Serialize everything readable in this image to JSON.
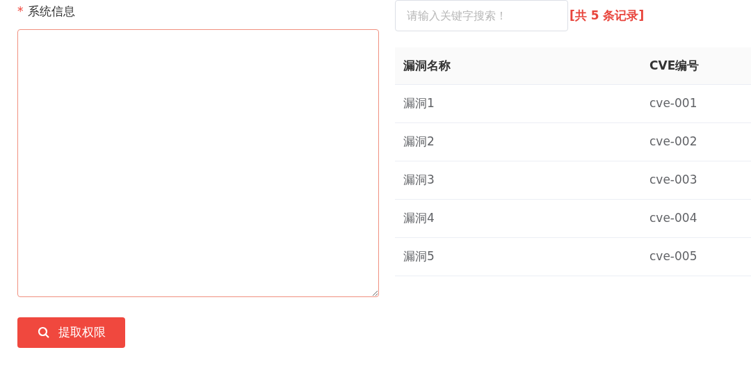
{
  "form": {
    "label_required": "*",
    "label": "系统信息",
    "button": "提取权限"
  },
  "search": {
    "placeholder": "请输入关键字搜索！",
    "count": "[共 5 条记录]"
  },
  "table": {
    "columns": [
      "漏洞名称",
      "CVE编号"
    ],
    "rows": [
      [
        "漏洞1",
        "cve-001"
      ],
      [
        "漏洞2",
        "cve-002"
      ],
      [
        "漏洞3",
        "cve-003"
      ],
      [
        "漏洞4",
        "cve-004"
      ],
      [
        "漏洞5",
        "cve-005"
      ]
    ]
  }
}
